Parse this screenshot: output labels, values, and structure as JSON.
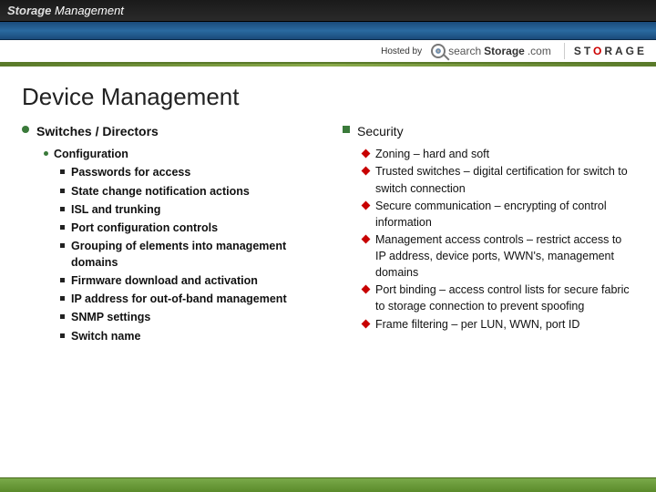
{
  "banner": {
    "brand_word1": "Storage",
    "brand_word2": "Management"
  },
  "hosted": {
    "hosted_by": "Hosted by",
    "search_word1": "search",
    "search_word2": "Storage",
    "search_word3": ".com",
    "storage_label": "STORAGE"
  },
  "page_title": "Device Management",
  "left": {
    "heading": "Switches / Directors",
    "sub_heading": "Configuration",
    "items": [
      "Passwords for access",
      "State change notification actions",
      "ISL and trunking",
      "Port configuration controls",
      "Grouping of elements into management domains",
      "Firmware download and activation",
      "IP address for out-of-band management",
      "SNMP settings",
      "Switch name"
    ]
  },
  "right": {
    "heading": "Security",
    "items": [
      "Zoning – hard and soft",
      "Trusted switches – digital certification for switch to switch connection",
      "Secure communication – encrypting of control information",
      "Management access controls – restrict access to IP address, device ports, WWN's, management domains",
      "Port binding – access control lists for secure fabric to storage connection to prevent spoofing",
      "Frame filtering – per LUN, WWN, port ID"
    ]
  }
}
